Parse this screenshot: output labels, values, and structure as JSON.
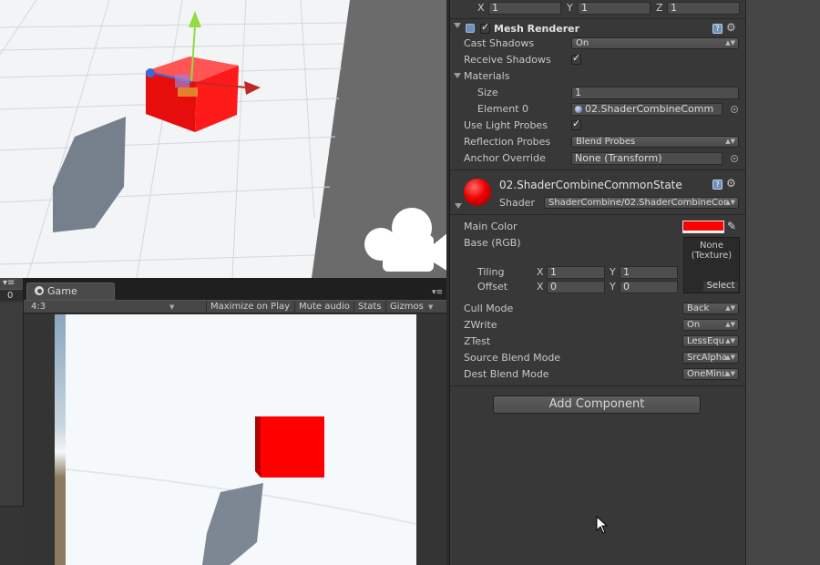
{
  "scene": {
    "title": "",
    "icons": [
      "move-gizmo-icon",
      "scene-camera-icon",
      "directional-shadow-icon"
    ],
    "cube_color": "#ff1a1a"
  },
  "left_panel": {
    "menu_glyph": "▾≡",
    "counter": "0"
  },
  "game_view": {
    "tab_label": "Game",
    "panel_menu_glyph": "▾≡",
    "aspect": "4:3",
    "buttons": [
      "Maximize on Play",
      "Mute audio",
      "Stats",
      "Gizmos"
    ],
    "cube_color": "#ff0000"
  },
  "inspector": {
    "transform_scale": {
      "x_label": "X",
      "x": "1",
      "y_label": "Y",
      "y": "1",
      "z_label": "Z",
      "z": "1"
    },
    "mesh_renderer": {
      "title": "Mesh Renderer",
      "cast_shadows_label": "Cast Shadows",
      "cast_shadows_value": "On",
      "receive_shadows_label": "Receive Shadows",
      "materials_label": "Materials",
      "size_label": "Size",
      "size_value": "1",
      "element0_label": "Element 0",
      "element0_value": "02.ShaderCombineComm",
      "use_light_probes_label": "Use Light Probes",
      "reflection_probes_label": "Reflection Probes",
      "reflection_probes_value": "Blend Probes",
      "anchor_override_label": "Anchor Override",
      "anchor_override_value": "None (Transform)"
    },
    "material": {
      "name": "02.ShaderCombineCommonState",
      "shader_label": "Shader",
      "shader_value": "ShaderCombine/02.ShaderCombineCor",
      "main_color_label": "Main Color",
      "main_color": "#ff0000",
      "base_label": "Base (RGB)",
      "texture_line1": "None",
      "texture_line2": "(Texture)",
      "texture_select": "Select",
      "tiling_label": "Tiling",
      "offset_label": "Offset",
      "tiling_x_label": "X",
      "tiling_x": "1",
      "tiling_y_label": "Y",
      "tiling_y": "1",
      "offset_x_label": "X",
      "offset_x": "0",
      "offset_y_label": "Y",
      "offset_y": "0",
      "cull_label": "Cull Mode",
      "cull_value": "Back",
      "zwrite_label": "ZWrite",
      "zwrite_value": "On",
      "ztest_label": "ZTest",
      "ztest_value": "LessEqu",
      "src_blend_label": "Source Blend Mode",
      "src_blend_value": "SrcAlpha",
      "dst_blend_label": "Dest Blend Mode",
      "dst_blend_value": "OneMinu"
    },
    "add_component": "Add Component"
  }
}
